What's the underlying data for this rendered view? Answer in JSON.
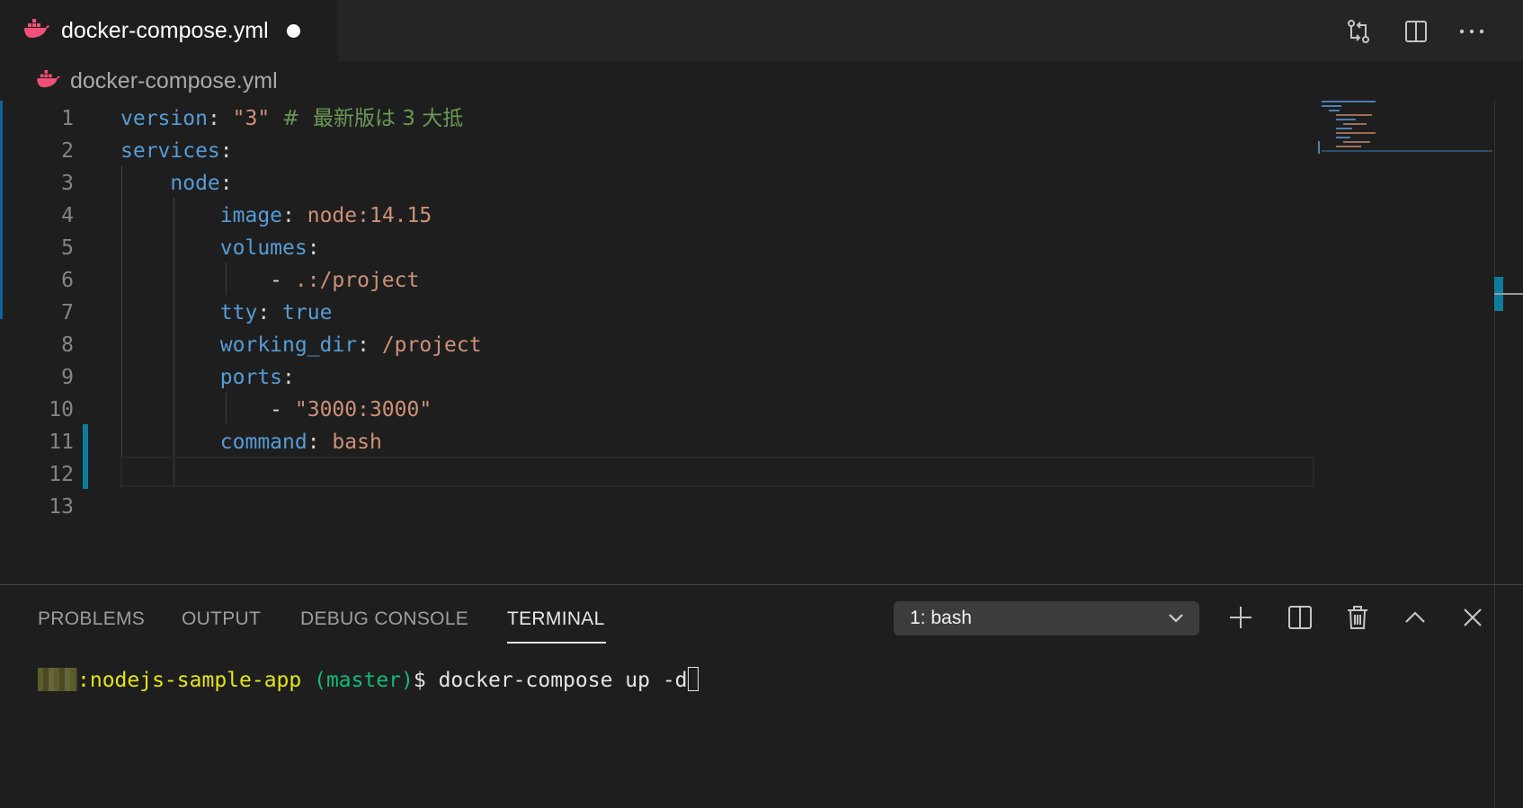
{
  "tab": {
    "title": "docker-compose.yml",
    "dirty": true
  },
  "breadcrumb": {
    "file": "docker-compose.yml"
  },
  "editor": {
    "lines": [
      {
        "n": "1",
        "tokens": [
          [
            "k",
            "version"
          ],
          [
            "p",
            ": "
          ],
          [
            "s",
            "\"3\""
          ],
          [
            "p",
            " "
          ],
          [
            "c",
            "#  最新版は 3 大抵"
          ]
        ]
      },
      {
        "n": "2",
        "tokens": [
          [
            "k",
            "services"
          ],
          [
            "p",
            ":"
          ]
        ]
      },
      {
        "n": "3",
        "tokens": [
          [
            "p",
            "    "
          ],
          [
            "k",
            "node"
          ],
          [
            "p",
            ":"
          ]
        ]
      },
      {
        "n": "4",
        "tokens": [
          [
            "p",
            "        "
          ],
          [
            "k",
            "image"
          ],
          [
            "p",
            ": "
          ],
          [
            "s",
            "node:14.15"
          ]
        ]
      },
      {
        "n": "5",
        "tokens": [
          [
            "p",
            "        "
          ],
          [
            "k",
            "volumes"
          ],
          [
            "p",
            ":"
          ]
        ]
      },
      {
        "n": "6",
        "tokens": [
          [
            "p",
            "            - "
          ],
          [
            "s",
            ".:/project"
          ]
        ]
      },
      {
        "n": "7",
        "tokens": [
          [
            "p",
            "        "
          ],
          [
            "k",
            "tty"
          ],
          [
            "p",
            ": "
          ],
          [
            "k",
            "true"
          ]
        ]
      },
      {
        "n": "8",
        "tokens": [
          [
            "p",
            "        "
          ],
          [
            "k",
            "working_dir"
          ],
          [
            "p",
            ": "
          ],
          [
            "s",
            "/project"
          ]
        ]
      },
      {
        "n": "9",
        "tokens": [
          [
            "p",
            "        "
          ],
          [
            "k",
            "ports"
          ],
          [
            "p",
            ":"
          ]
        ]
      },
      {
        "n": "10",
        "tokens": [
          [
            "p",
            "            - "
          ],
          [
            "s",
            "\"3000:3000\""
          ]
        ]
      },
      {
        "n": "11",
        "tokens": [
          [
            "p",
            "        "
          ],
          [
            "k",
            "command"
          ],
          [
            "p",
            ": "
          ],
          [
            "s",
            "bash"
          ]
        ]
      },
      {
        "n": "12",
        "tokens": []
      },
      {
        "n": "13",
        "tokens": []
      }
    ]
  },
  "panel": {
    "tabs": [
      "PROBLEMS",
      "OUTPUT",
      "DEBUG CONSOLE",
      "TERMINAL"
    ],
    "active_tab": "TERMINAL",
    "terminal_select": "1: bash",
    "terminal": {
      "prompt_path": ":nodejs-sample-app",
      "branch": " (master)",
      "prompt_symbol": "$ ",
      "command": "docker-compose up -d"
    }
  },
  "colors": {
    "accent": "#0c7d9d",
    "keyword": "#569cd6",
    "string": "#ce9178",
    "comment": "#6a9955",
    "docker_icon": "#f0517a"
  }
}
